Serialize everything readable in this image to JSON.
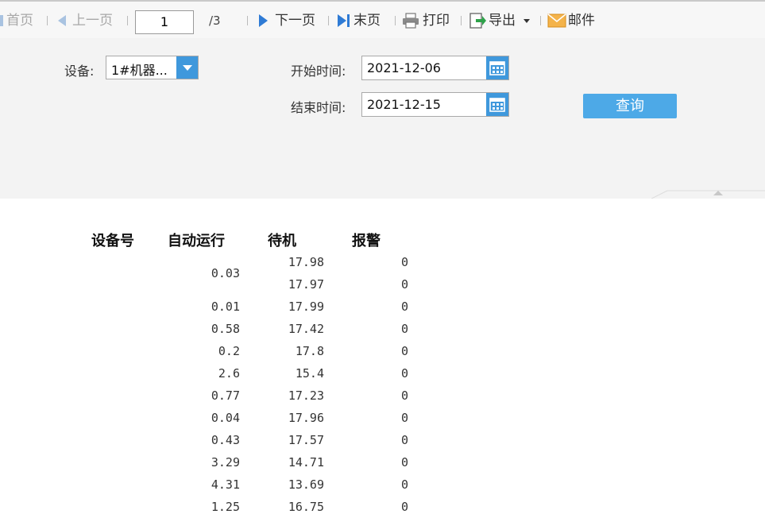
{
  "toolbar": {
    "first": "首页",
    "prev": "上一页",
    "page_value": "1",
    "total": "/3",
    "next": "下一页",
    "last": "末页",
    "print": "打印",
    "export": "导出",
    "mail": "邮件"
  },
  "form": {
    "device_label": "设备:",
    "device_value": "1#机器...",
    "start_label": "开始时间:",
    "start_value": "2021-12-06",
    "end_label": "结束时间:",
    "end_value": "2021-12-15",
    "query_label": "查询"
  },
  "table": {
    "headers": [
      "设备号",
      "自动运行",
      "待机",
      "报警"
    ],
    "auto_run": [
      "0.03",
      "0.01",
      "0.58",
      "0.2",
      "2.6",
      "0.77",
      "0.04",
      "0.43",
      "3.29",
      "4.31",
      "1.25"
    ],
    "standby": [
      "17.98",
      "17.97",
      "17.99",
      "17.42",
      "17.8",
      "15.4",
      "17.23",
      "17.96",
      "17.57",
      "14.71",
      "13.69",
      "16.75"
    ],
    "alarm": [
      "0",
      "0",
      "0",
      "0",
      "0",
      "0",
      "0",
      "0",
      "0",
      "0",
      "0",
      "0"
    ]
  },
  "colors": {
    "accent": "#3f98dc",
    "button": "#4da9e7",
    "arrow": "#2f7bd5"
  }
}
